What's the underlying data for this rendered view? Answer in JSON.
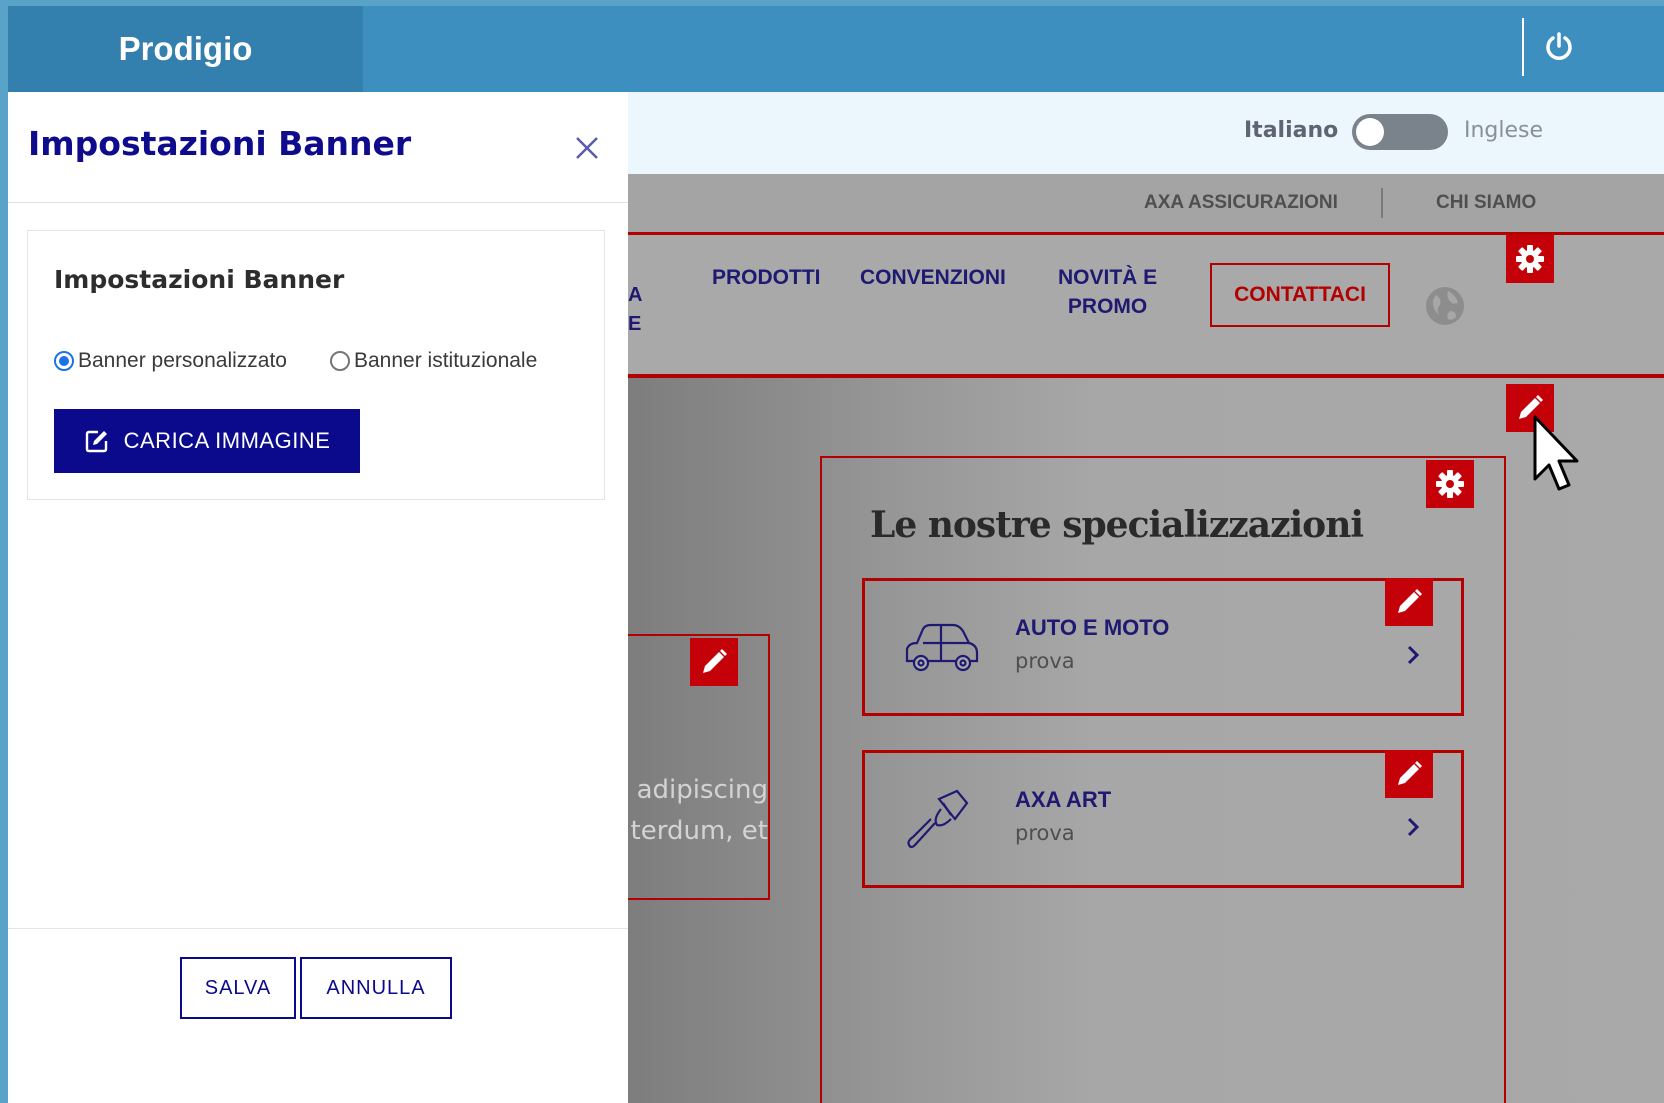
{
  "app": {
    "brand": "Prodigio"
  },
  "language": {
    "left": "Italiano",
    "right": "Inglese"
  },
  "site": {
    "utility_links": [
      "AXA ASSICURAZIONI",
      "CHI SIAMO"
    ],
    "nav_fragment": "A\nE",
    "nav": [
      {
        "label": "PRODOTTI"
      },
      {
        "label": "CONVENZIONI"
      },
      {
        "label": "NOVITÀ E\nPROMO"
      }
    ],
    "contact_label": "CONTATTACI",
    "hero_text": "adipiscing\nterdum, et",
    "specializations": {
      "title": "Le nostre specializzazioni",
      "cards": [
        {
          "title": "AUTO E MOTO",
          "subtitle": "prova",
          "icon": "car-icon"
        },
        {
          "title": "AXA ART",
          "subtitle": "prova",
          "icon": "paintbrush-icon"
        }
      ]
    }
  },
  "panel": {
    "title": "Impostazioni Banner",
    "section_title": "Impostazioni Banner",
    "radio_options": [
      {
        "label": "Banner personalizzato",
        "checked": true
      },
      {
        "label": "Banner istituzionale",
        "checked": false
      }
    ],
    "upload_label": "CARICA IMMAGINE",
    "save_label": "SALVA",
    "cancel_label": "ANNULLA"
  },
  "colors": {
    "app_bar": "#3d8fc0",
    "brand_bg": "#337fae",
    "primary": "#0b0a8c",
    "edit_red": "#c40009"
  }
}
